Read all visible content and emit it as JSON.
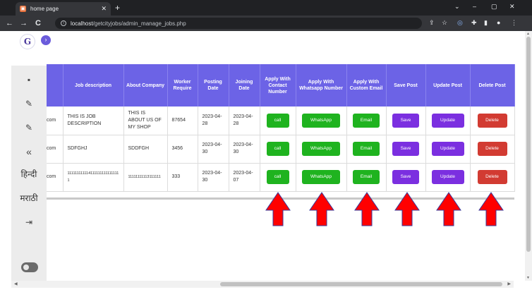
{
  "browser": {
    "tab_title": "home page",
    "tab_close": "✕",
    "new_tab": "+",
    "url_host": "localhost",
    "url_path": "/getcityjobs/admin_manage_jobs.php",
    "back": "←",
    "forward": "→",
    "reload": "C",
    "chevron": "⌄",
    "minimize": "–",
    "maximize": "▢",
    "close": "✕",
    "menu": "⋮"
  },
  "app": {
    "logo_text": "G",
    "collapse_icon": "›"
  },
  "sidebar": {
    "items": [
      {
        "icon": "dashboard-icon",
        "glyph": "▪"
      },
      {
        "icon": "wrench-icon",
        "glyph": "✎"
      },
      {
        "icon": "tools-icon",
        "glyph": "✎"
      },
      {
        "icon": "double-chevron-left-icon",
        "glyph": "«"
      }
    ],
    "lang_hindi": "हिन्दी",
    "lang_marathi": "मराठी",
    "logout_glyph": "⇥"
  },
  "table": {
    "headers": [
      "",
      "Job description",
      "About Company",
      "Worker Require",
      "Posting Date",
      "Joining Date",
      "Apply With Contact Number",
      "Apply With Whatsapp Number",
      "Apply With Custom Email",
      "Save Post",
      "Update Post",
      "Delete Post"
    ],
    "rows": [
      {
        "email_tail": "com",
        "description": "THIS IS JOB DESCRIPTION",
        "about": "THIS IS ABOUT US OF MY SHOP",
        "workers": "87654",
        "posting": "2023-04-28",
        "joining": "2023-04-28"
      },
      {
        "email_tail": "com",
        "description": "SDFGHJ",
        "about": "SDDFGH",
        "workers": "3456",
        "posting": "2023-04-30",
        "joining": "2023-04-30"
      },
      {
        "email_tail": "com",
        "description": "1111111111141111111111111111",
        "about": "11111111113111111",
        "workers": "333",
        "posting": "2023-04-30",
        "joining": "2023-04-07"
      }
    ],
    "buttons": {
      "call": "call",
      "whatsapp": "WhatsApp",
      "email": "Email",
      "save": "Save",
      "update": "Update",
      "delete": "Delete"
    }
  },
  "colors": {
    "header": "#6c63e6",
    "green": "#1fb31f",
    "purple": "#7b2fe0",
    "red": "#d23b32",
    "arrow": "#ff0000"
  }
}
